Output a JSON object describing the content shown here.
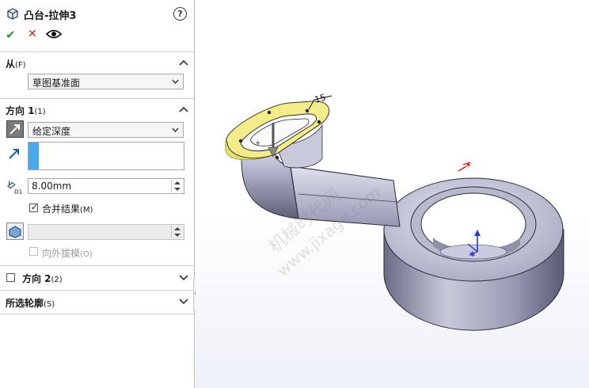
{
  "header": {
    "title": "凸台-拉伸3",
    "help_glyph": "?"
  },
  "actions": {
    "ok": "✔",
    "cancel": "✕"
  },
  "from_section": {
    "title": "从",
    "hotkey": "(F)",
    "value": "草图基准面"
  },
  "direction1": {
    "title": "方向 1",
    "hotkey": "(1)",
    "end_condition": "给定深度",
    "depth": "8.00mm",
    "depth_label": "D1",
    "merge_label": "合并结果",
    "merge_hotkey": "(M)",
    "merge_checked": true,
    "draft_label": "向外拔模",
    "draft_hotkey": "(O)"
  },
  "direction2": {
    "title": "方向 2",
    "hotkey": "(2)"
  },
  "selected_contours": {
    "title": "所选轮廓",
    "hotkey": "(S)"
  },
  "viewport": {
    "dimension_label": "15",
    "watermark_line1": "机械时代网",
    "watermark_line2": "www.jixage.com"
  },
  "colors": {
    "accent_blue": "#4aa7ea",
    "ok_green": "#2f9a2f",
    "cancel_red": "#cc2222",
    "preview_yellow": "#f3ec8a",
    "part_gray": "#a4a7bf"
  }
}
